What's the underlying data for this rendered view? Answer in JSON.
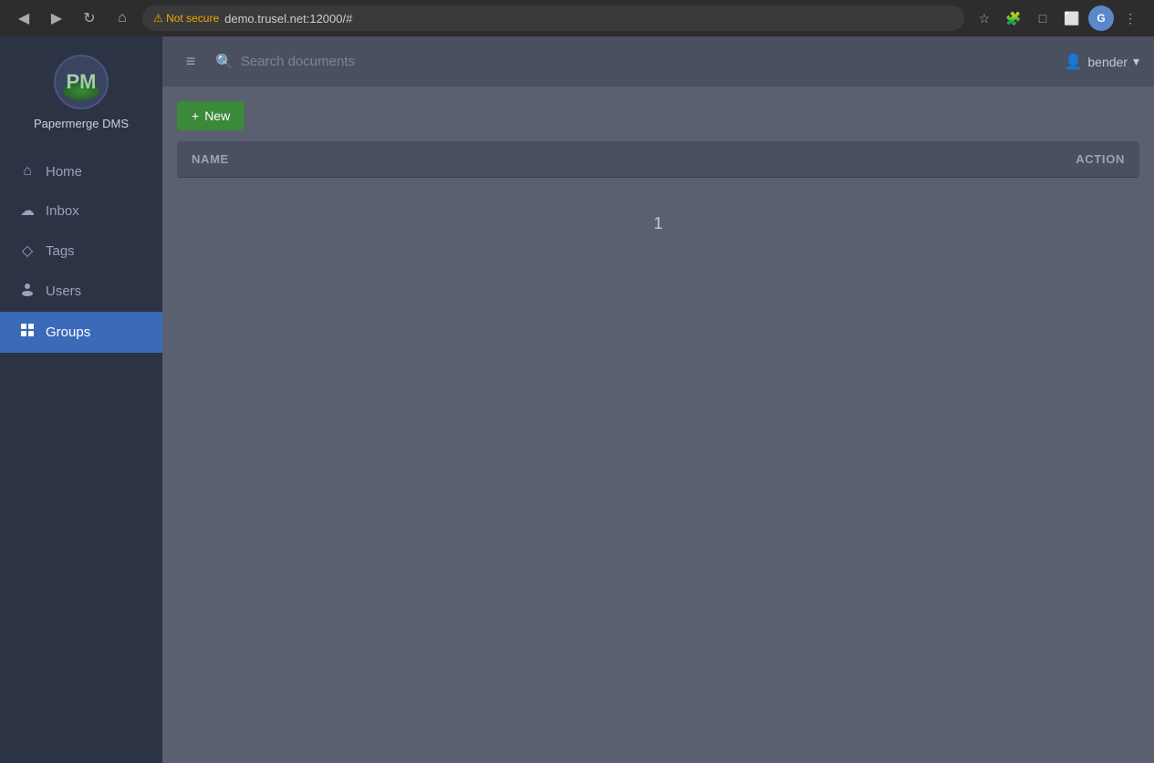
{
  "browser": {
    "back_icon": "◀",
    "forward_icon": "▶",
    "reload_icon": "↻",
    "home_icon": "⌂",
    "security_warning": "⚠ Not secure",
    "url": "demo.trusel.net:12000/#",
    "star_icon": "☆",
    "ext1_icon": "🧩",
    "ext2_icon": "□",
    "sidebar_icon": "⬜",
    "profile_label": "G",
    "menu_icon": "⋮"
  },
  "sidebar": {
    "logo_initials": "PM",
    "app_name": "Papermerge DMS",
    "nav_items": [
      {
        "id": "home",
        "label": "Home",
        "icon": "⌂",
        "active": false
      },
      {
        "id": "inbox",
        "label": "Inbox",
        "icon": "☁",
        "active": false
      },
      {
        "id": "tags",
        "label": "Tags",
        "icon": "🏷",
        "active": false
      },
      {
        "id": "users",
        "label": "Users",
        "icon": "👤",
        "active": false
      },
      {
        "id": "groups",
        "label": "Groups",
        "icon": "▦",
        "active": true
      }
    ]
  },
  "header": {
    "menu_icon": "≡",
    "search_placeholder": "Search documents",
    "search_icon": "🔍",
    "user_icon": "👤",
    "username": "bender",
    "dropdown_icon": "▾"
  },
  "toolbar": {
    "new_button_icon": "+",
    "new_button_label": "New"
  },
  "table": {
    "columns": [
      {
        "id": "name",
        "label": "NAME"
      },
      {
        "id": "action",
        "label": "ACTION"
      }
    ],
    "rows": [],
    "pagination": "1"
  }
}
